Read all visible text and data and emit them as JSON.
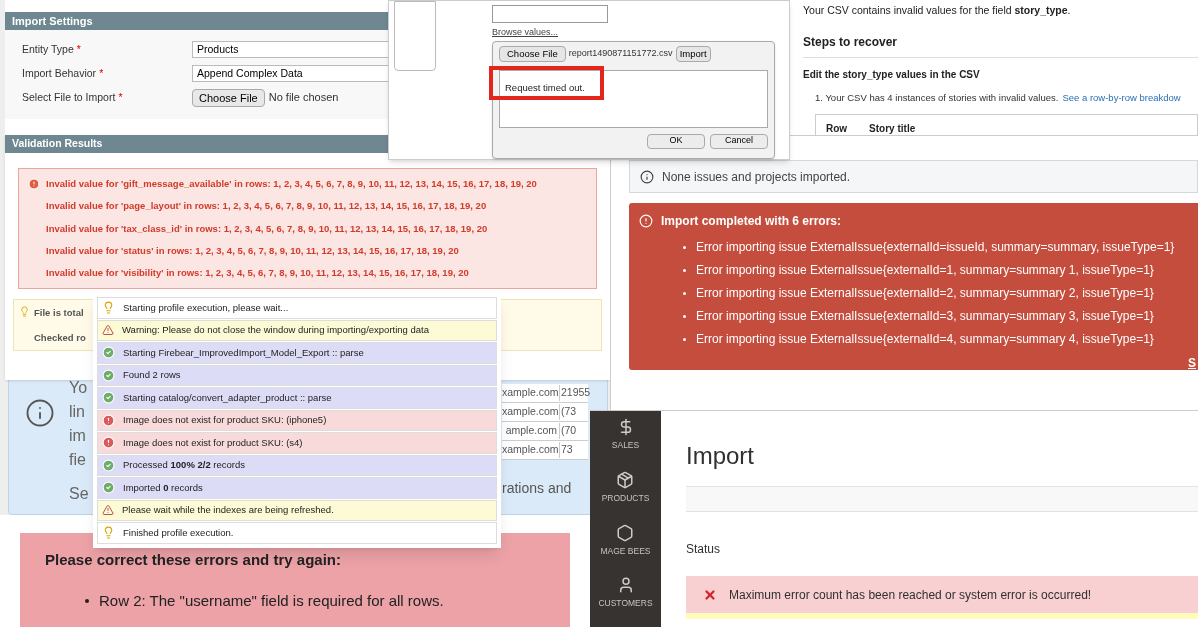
{
  "import_settings": {
    "title": "Import Settings",
    "fields": [
      {
        "label": "Entity Type",
        "required_mark": "*",
        "kind": "select",
        "value": "Products"
      },
      {
        "label": "Import Behavior",
        "required_mark": "*",
        "kind": "select",
        "value": "Append Complex Data"
      },
      {
        "label": "Select File to Import",
        "required_mark": "*",
        "kind": "file",
        "button": "Choose File",
        "value": "No file chosen"
      }
    ]
  },
  "validation_results": {
    "title": "Validation Results",
    "errors": [
      "Invalid value for 'gift_message_available' in rows: 1, 2, 3, 4, 5, 6, 7, 8, 9, 10, 11, 12, 13, 14, 15, 16, 17, 18, 19, 20",
      "Invalid value for 'page_layout' in rows: 1, 2, 3, 4, 5, 6, 7, 8, 9, 10, 11, 12, 13, 14, 15, 16, 17, 18, 19, 20",
      "Invalid value for 'tax_class_id' in rows: 1, 2, 3, 4, 5, 6, 7, 8, 9, 10, 11, 12, 13, 14, 15, 16, 17, 18, 19, 20",
      "Invalid value for 'status' in rows: 1, 2, 3, 4, 5, 6, 7, 8, 9, 10, 11, 12, 13, 14, 15, 16, 17, 18, 19, 20",
      "Invalid value for 'visibility' in rows: 1, 2, 3, 4, 5, 6, 7, 8, 9, 10, 11, 12, 13, 14, 15, 16, 17, 18, 19, 20"
    ],
    "notices": [
      "File is total",
      "Checked ro"
    ]
  },
  "upload_dialog": {
    "link": "Browse values...",
    "choose_button": "Choose File",
    "file_name": "report1490871151772.csv",
    "import_button": "Import",
    "message": "Request timed out.",
    "buttons": [
      "OK",
      "Cancel"
    ]
  },
  "csv_help": {
    "message": "Your CSV contains invalid values for the field **story_type**.",
    "heading": "Steps to recover",
    "subheading": "Edit the story_type values in the CSV",
    "step": "1. Your CSV has 4 instances of stories with invalid values.",
    "link": "See a row-by-row breakdow",
    "columns": [
      "Row",
      "Story title"
    ]
  },
  "issue_import": {
    "info": "None issues and projects imported.",
    "error_title": "Import completed with 6 errors:",
    "errors": [
      "Error importing issue ExternalIssue{externalId=issueId, summary=summary, issueType=1}",
      "Error importing issue ExternalIssue{externalId=1, summary=summary 1, issueType=1}",
      "Error importing issue ExternalIssue{externalId=2, summary=summary 2, issueType=1}",
      "Error importing issue ExternalIssue{externalId=3, summary=summary 3, issueType=1}",
      "Error importing issue ExternalIssue{externalId=4, summary=summary 4, issueType=1}"
    ],
    "link": "S"
  },
  "info_panel": {
    "lines": [
      "Yo",
      "lin",
      "im",
      "fie",
      "Se"
    ],
    "rows": [
      [
        "xample.com",
        "21955"
      ],
      [
        "xample.com",
        "(73"
      ],
      [
        "ample.com",
        "(70"
      ],
      [
        "xample.com",
        "73"
      ]
    ],
    "tail": "rations and"
  },
  "log": [
    {
      "kind": "info",
      "text": "Starting profile execution, please wait..."
    },
    {
      "kind": "warning",
      "text": "Warning: Please do not close the window during importing/exporting data"
    },
    {
      "kind": "success",
      "text": "Starting Firebear_ImprovedImport_Model_Export :: parse"
    },
    {
      "kind": "success",
      "text": "Found 2 rows"
    },
    {
      "kind": "success",
      "text": "Starting catalog/convert_adapter_product :: parse"
    },
    {
      "kind": "error",
      "text": "Image does not exist for product SKU: (iphone5)"
    },
    {
      "kind": "error",
      "text": "Image does not exist for product SKU: (s4)"
    },
    {
      "kind": "success",
      "text": "Processed **100% 2/2** records"
    },
    {
      "kind": "success",
      "text": "Imported **0** records"
    },
    {
      "kind": "warning",
      "text": "Please wait while the indexes are being refreshed."
    },
    {
      "kind": "info",
      "text": "Finished profile execution."
    }
  ],
  "form_errors": {
    "title": "Please correct these errors and try again:",
    "items": [
      "Row 2: The \"username\" field is required for all rows."
    ]
  },
  "admin": {
    "nav": [
      {
        "kind": "dollar",
        "label": "SALES"
      },
      {
        "kind": "box",
        "label": "PRODUCTS"
      },
      {
        "kind": "hexagon",
        "label": "MAGE BEES"
      },
      {
        "kind": "person",
        "label": "CUSTOMERS"
      }
    ],
    "title": "Import",
    "status_label": "Status",
    "error": "Maximum error count has been reached or system error is occurred!"
  }
}
